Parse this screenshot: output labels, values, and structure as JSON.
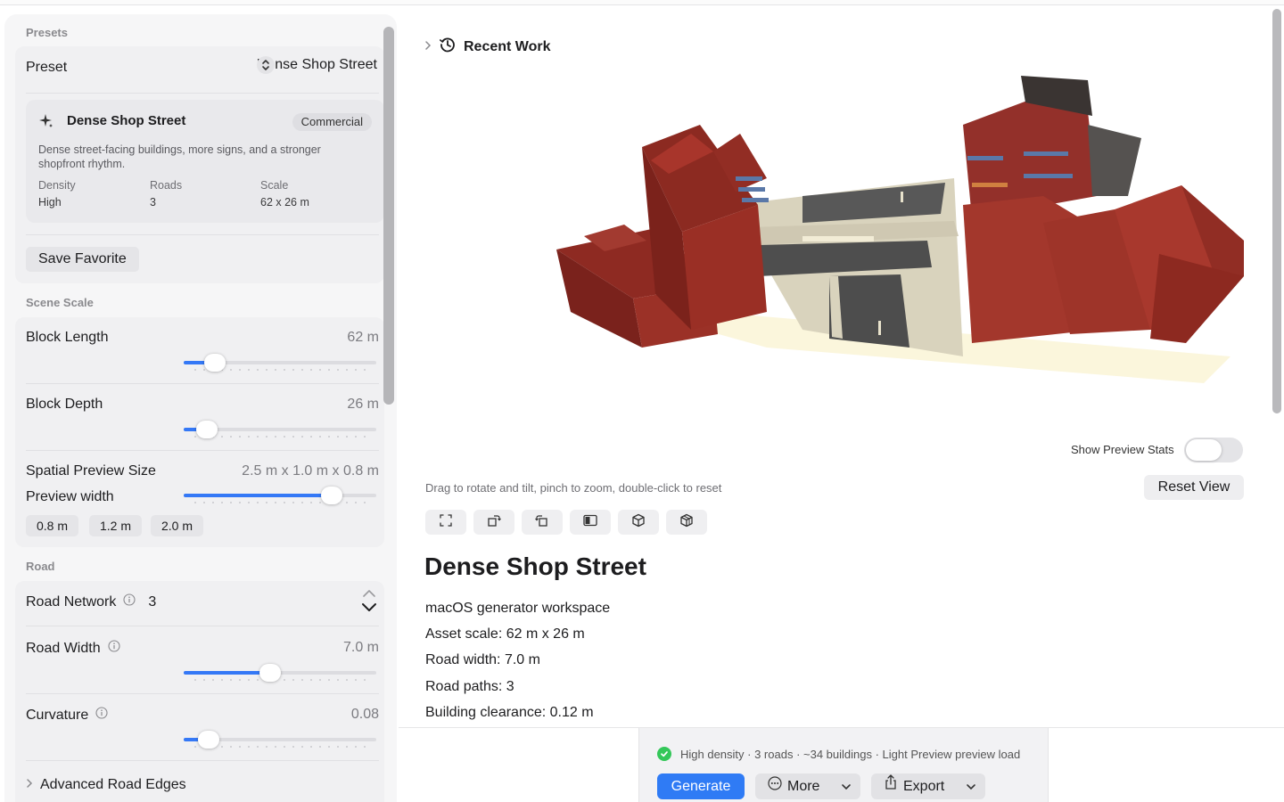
{
  "sidebar": {
    "presets": {
      "section_title": "Presets",
      "preset_label": "Preset",
      "preset_value": "Dense Shop Street",
      "card": {
        "title": "Dense Shop Street",
        "badge": "Commercial",
        "description": "Dense street-facing buildings, more signs, and a stronger shopfront rhythm.",
        "stats": [
          {
            "label": "Density",
            "value": "High"
          },
          {
            "label": "Roads",
            "value": "3"
          },
          {
            "label": "Scale",
            "value": "62 x 26 m"
          }
        ]
      },
      "save_favorite": "Save Favorite"
    },
    "scene_scale": {
      "section_title": "Scene Scale",
      "block_length": {
        "label": "Block Length",
        "value": "62 m",
        "fraction": 0.16
      },
      "block_depth": {
        "label": "Block Depth",
        "value": "26 m",
        "fraction": 0.12
      },
      "spatial_preview": {
        "label": "Spatial Preview Size",
        "value": "2.5 m x 1.0 m x 0.8 m",
        "sublabel": "Preview width",
        "fraction": 0.77,
        "chips": [
          "0.8 m",
          "1.2 m",
          "2.0 m"
        ]
      }
    },
    "road": {
      "section_title": "Road",
      "road_network": {
        "label": "Road Network",
        "value": "3"
      },
      "road_width": {
        "label": "Road Width",
        "value": "7.0 m",
        "fraction": 0.45
      },
      "curvature": {
        "label": "Curvature",
        "value": "0.08",
        "fraction": 0.13
      },
      "advanced": "Advanced Road Edges"
    }
  },
  "main": {
    "recent_work": "Recent Work",
    "show_stats_label": "Show Preview Stats",
    "show_stats_on": false,
    "hint": "Drag to rotate and tilt, pinch to zoom, double-click to reset",
    "reset_view": "Reset View",
    "tools": [
      "fit-icon",
      "rotate-left-icon",
      "rotate-right-icon",
      "side-view-icon",
      "cube-icon",
      "wireframe-cube-icon"
    ],
    "title": "Dense Shop Street",
    "details": [
      "macOS generator workspace",
      "Asset scale: 62 m x 26 m",
      "Road width: 7.0 m",
      "Road paths: 3",
      "Building clearance: 0.12 m"
    ]
  },
  "bottom_bar": {
    "status": "High density · 3 roads · ~34 buildings · Light Preview preview load",
    "generate": "Generate",
    "more": "More",
    "export": "Export"
  },
  "colors": {
    "accent": "#3478f6",
    "roof_red": "#9a2c22",
    "road_dark": "#4a4a4a",
    "sidewalk": "#d8d2be",
    "success": "#34c759"
  }
}
